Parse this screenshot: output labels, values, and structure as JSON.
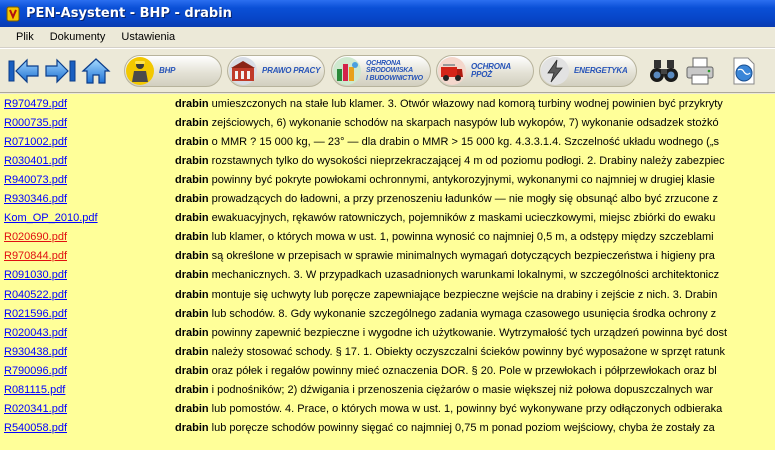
{
  "window": {
    "title": "PEN-Asystent - BHP - drabin"
  },
  "menu": [
    {
      "label": "Plik"
    },
    {
      "label": "Dokumenty"
    },
    {
      "label": "Ustawienia"
    }
  ],
  "toolbar": {
    "categories": [
      {
        "id": "bhp",
        "lines": [
          "BHP"
        ]
      },
      {
        "id": "prawo",
        "lines": [
          "PRAWO PRACY"
        ]
      },
      {
        "id": "ochrona-srodowiska",
        "lines": [
          "OCHRONA",
          "ŚRODOWISKA",
          "I BUDOWNICTWO"
        ]
      },
      {
        "id": "ochrona-ppoz",
        "lines": [
          "OCHRONA PPOŻ"
        ]
      },
      {
        "id": "energetyka",
        "lines": [
          "ENERGETYKA"
        ]
      }
    ]
  },
  "results": [
    {
      "file": "R970479.pdf",
      "visited": false,
      "keyword": "drabin",
      "text": " umieszczonych na stałe lub klamer. 3. Otwór włazowy nad komorą turbiny wodnej powinien być przykryty"
    },
    {
      "file": "R000735.pdf",
      "visited": false,
      "keyword": "drabin",
      "text": " zejściowych, 6) wykonanie schodów na skarpach nasypów lub wykopów, 7) wykonanie odsadzek stożkó"
    },
    {
      "file": "R071002.pdf",
      "visited": false,
      "keyword": "drabin",
      "text": " o MMR ? 15 000 kg, — 23° — dla drabin o MMR > 15 000 kg. 4.3.3.1.4. Szczelność układu wodnego („s"
    },
    {
      "file": "R030401.pdf",
      "visited": false,
      "keyword": "drabin",
      "text": " rozstawnych tylko do wysokości nieprzekraczającej 4 m od poziomu podłogi. 2. Drabiny należy zabezpiec"
    },
    {
      "file": "R940073.pdf",
      "visited": false,
      "keyword": "drabin",
      "text": " powinny być pokryte powłokami ochronnymi, antykorozyjnymi, wykonanymi co najmniej w drugiej klasie"
    },
    {
      "file": "R930346.pdf",
      "visited": false,
      "keyword": "drabin",
      "text": " prowadzących do ładowni, a przy przenoszeniu ładunków — nie mogły się obsunąć albo być zrzucone z"
    },
    {
      "file": "Kom_OP_2010.pdf",
      "visited": false,
      "keyword": "drabin",
      "text": " ewakuacyjnych, rękawów ratowniczych, pojemników z maskami ucieczkowymi, miejsc zbiórki do ewaku"
    },
    {
      "file": "R020690.pdf",
      "visited": true,
      "keyword": "drabin",
      "text": " lub klamer, o których mowa w ust. 1, powinna wynosić co najmniej 0,5 m, a odstępy między szczeblami"
    },
    {
      "file": "R970844.pdf",
      "visited": true,
      "keyword": "drabin",
      "text": " są określone w przepisach w sprawie minimalnych wymagań dotyczących bezpieczeństwa i higieny pra"
    },
    {
      "file": "R091030.pdf",
      "visited": false,
      "keyword": "drabin",
      "text": " mechanicznych. 3. W przypadkach uzasadnionych warunkami lokalnymi, w szczególności architektonicz"
    },
    {
      "file": "R040522.pdf",
      "visited": false,
      "keyword": "drabin",
      "text": " montuje się uchwyty lub poręcze zapewniające bezpieczne wejście na drabiny i zejście z nich. 3. Drabin"
    },
    {
      "file": "R021596.pdf",
      "visited": false,
      "keyword": "drabin",
      "text": " lub schodów. 8. Gdy wykonanie szczególnego zadania wymaga czasowego usunięcia środka ochrony z"
    },
    {
      "file": "R020043.pdf",
      "visited": false,
      "keyword": "drabin",
      "text": " powinny zapewnić bezpieczne i wygodne ich użytkowanie. Wytrzymałość tych urządzeń powinna być dost"
    },
    {
      "file": "R930438.pdf",
      "visited": false,
      "keyword": "drabin",
      "text": " należy stosować schody. § 17. 1. Obiekty oczyszczalni ścieków powinny być wyposażone w sprzęt ratunk"
    },
    {
      "file": "R790096.pdf",
      "visited": false,
      "keyword": "drabin",
      "text": " oraz półek i regałów powinny mieć oznaczenia DOR. § 20. Pole w przewłokach i półprzewłokach oraz bl"
    },
    {
      "file": "R081115.pdf",
      "visited": false,
      "keyword": "drabin",
      "text": " i podnośników; 2) dźwigania i przenoszenia ciężarów o masie większej niż połowa dopuszczalnych war"
    },
    {
      "file": "R020341.pdf",
      "visited": false,
      "keyword": "drabin",
      "text": " lub pomostów. 4. Prace, o których mowa w ust. 1, powinny być wykonywane przy odłączonych odbieraka"
    },
    {
      "file": "R540058.pdf",
      "visited": false,
      "keyword": "drabin",
      "text": " lub poręcze schodów powinny sięgać co najmniej 0,75 m ponad poziom wejściowy, chyba że zostały za"
    }
  ]
}
